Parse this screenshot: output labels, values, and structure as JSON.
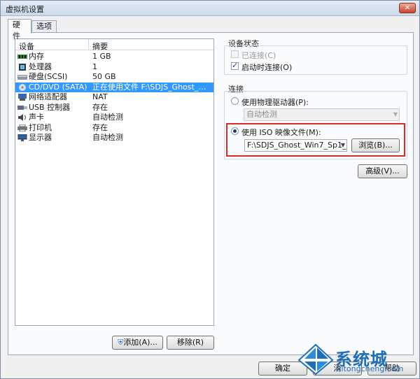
{
  "window": {
    "title": "虚拟机设置"
  },
  "tabs": [
    {
      "label": "硬件",
      "active": true
    },
    {
      "label": "选项",
      "active": false
    }
  ],
  "device_list": {
    "headers": {
      "device": "设备",
      "summary": "摘要"
    },
    "rows": [
      {
        "name": "内存",
        "summary": "1 GB",
        "icon": "memory-icon"
      },
      {
        "name": "处理器",
        "summary": "1",
        "icon": "processor-icon"
      },
      {
        "name": "硬盘(SCSI)",
        "summary": "50 GB",
        "icon": "hard-disk-icon"
      },
      {
        "name": "CD/DVD (SATA)",
        "summary": "正在使用文件 F:\\SDJS_Ghost_Win7...",
        "icon": "cd-dvd-icon",
        "selected": true
      },
      {
        "name": "网络适配器",
        "summary": "NAT",
        "icon": "network-adapter-icon"
      },
      {
        "name": "USB 控制器",
        "summary": "存在",
        "icon": "usb-icon"
      },
      {
        "name": "声卡",
        "summary": "自动检测",
        "icon": "sound-card-icon"
      },
      {
        "name": "打印机",
        "summary": "存在",
        "icon": "printer-icon"
      },
      {
        "name": "显示器",
        "summary": "自动检测",
        "icon": "display-icon"
      }
    ]
  },
  "list_buttons": {
    "add": "添加(A)...",
    "remove": "移除(R)"
  },
  "device_status": {
    "label": "设备状态",
    "connected": {
      "label": "已连接(C)",
      "checked": false,
      "enabled": false
    },
    "connect_at_power_on": {
      "label": "启动时连接(O)",
      "checked": true
    }
  },
  "connection": {
    "label": "连接",
    "physical": {
      "label": "使用物理驱动器(P):",
      "selected": false,
      "combo_value": "自动检测"
    },
    "iso": {
      "label": "使用 ISO 映像文件(M):",
      "selected": true,
      "combo_value": "F:\\SDJS_Ghost_Win7_Sp1_",
      "browse": "浏览(B)..."
    }
  },
  "advanced_button": "高级(V)...",
  "footer": {
    "ok": "确定",
    "cancel": "消",
    "help": "帮助"
  },
  "watermark": {
    "brand": "系统城",
    "site": "xitongcheng.com"
  },
  "colors": {
    "selection": "#3399ff",
    "highlight_border": "#d42a2a",
    "watermark": "#1f6fb8"
  }
}
